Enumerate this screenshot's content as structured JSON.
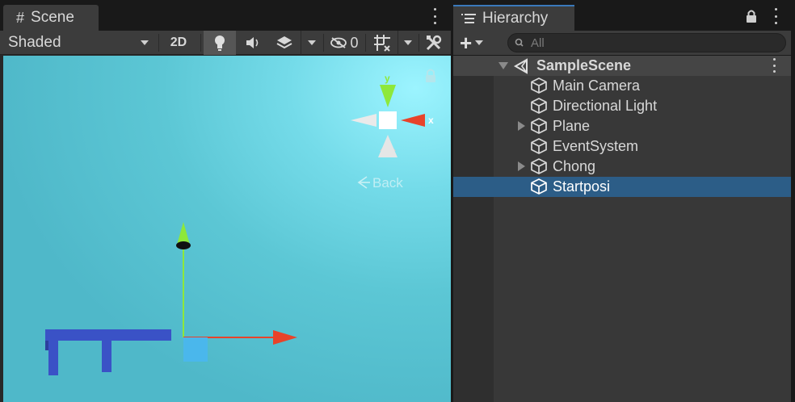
{
  "scene_panel": {
    "tab_icon": "#",
    "tab_title": "Scene",
    "shading_mode": "Shaded",
    "btn_2d": "2D",
    "hidden_count": "0",
    "viewport": {
      "orientation_gizmo": {
        "y_label": "y",
        "x_label": "x",
        "view_label": "Back"
      },
      "colors": {
        "x_axis": "#e8432a",
        "y_axis": "#8ee83a",
        "object": "#3a52c6",
        "selection_box": "#4ab7ec"
      }
    }
  },
  "hierarchy_panel": {
    "tab_icon": "list-icon",
    "tab_title": "Hierarchy",
    "add_label": "+",
    "search_placeholder": "All",
    "scene": {
      "name": "SampleScene"
    },
    "items": [
      {
        "label": "Main Camera",
        "has_children": false,
        "selected": false
      },
      {
        "label": "Directional Light",
        "has_children": false,
        "selected": false
      },
      {
        "label": "Plane",
        "has_children": true,
        "selected": false
      },
      {
        "label": "EventSystem",
        "has_children": false,
        "selected": false
      },
      {
        "label": "Chong",
        "has_children": true,
        "selected": false
      },
      {
        "label": "Startposi",
        "has_children": false,
        "selected": true
      }
    ]
  },
  "theme": {
    "selected_row": "#2c5d87",
    "tab_accent": "#3a79bb"
  }
}
